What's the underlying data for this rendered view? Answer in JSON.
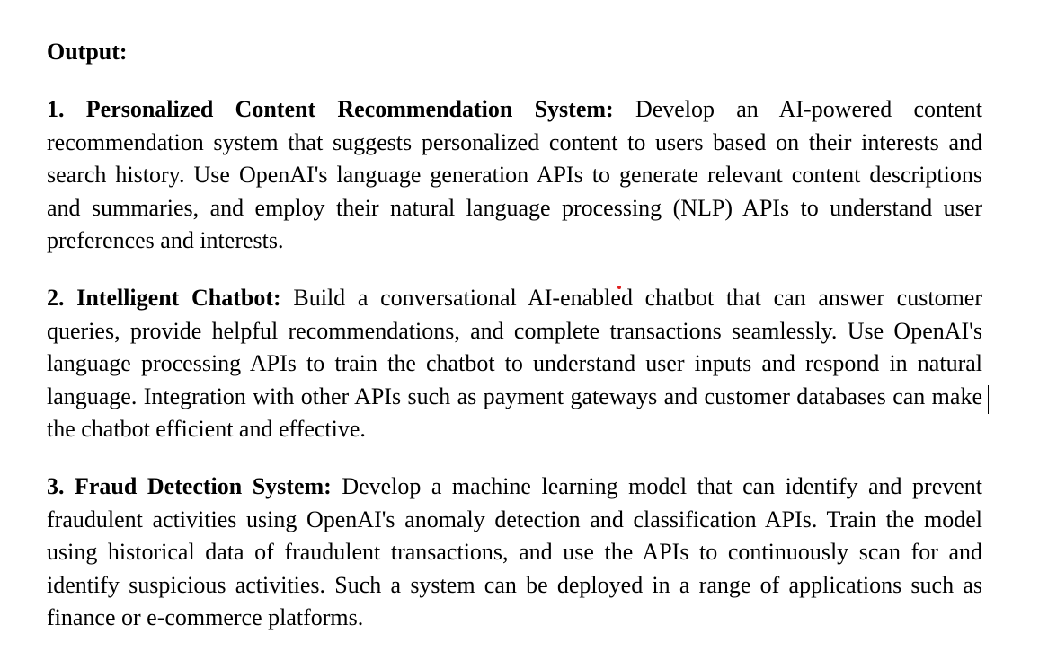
{
  "document": {
    "heading": "Output:",
    "items": [
      {
        "number": "1.",
        "title": "Personalized Content Recommendation System:",
        "body": "Develop an AI-powered content recommendation system that suggests personalized content to users based on their interests and search history. Use OpenAI's language generation APIs to generate relevant content descriptions and summaries, and employ their natural language processing (NLP) APIs to understand user preferences and interests."
      },
      {
        "number": "2.",
        "title": "Intelligent Chatbot:",
        "body": "Build a conversational AI-enabled chatbot that can answer customer queries, provide helpful recommendations, and complete transactions seamlessly. Use OpenAI's language processing APIs to train the chatbot to understand user inputs and respond in natural language. Integration with other APIs such as payment gateways and customer databases can make the chatbot efficient and effective."
      },
      {
        "number": "3.",
        "title": "Fraud Detection System:",
        "body": "Develop a machine learning model that can identify and prevent fraudulent activities using OpenAI's anomaly detection and classification APIs. Train the model using historical data of fraudulent transactions, and use the APIs to continuously scan for and identify suspicious activities. Such a system can be deployed in a range of applications such as finance or e-commerce platforms."
      }
    ]
  },
  "colors": {
    "text": "#000000",
    "background": "#ffffff",
    "marker_dot": "#e02020"
  }
}
